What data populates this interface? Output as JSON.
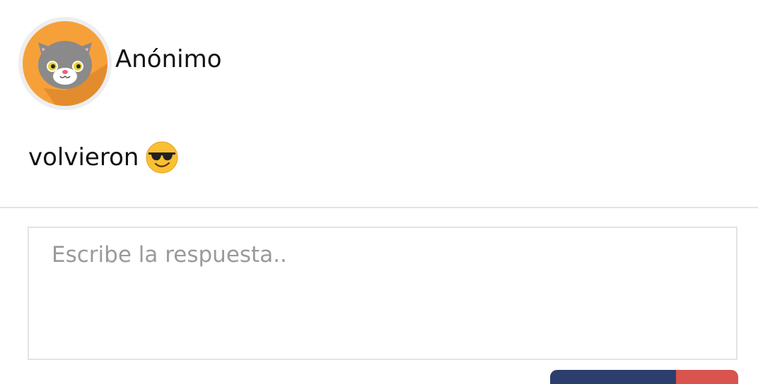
{
  "post": {
    "author": "Anónimo",
    "avatar_icon": "cat-avatar-icon",
    "message": "volvieron",
    "emoji_icon": "sunglasses-smile-emoji-icon"
  },
  "reply": {
    "placeholder": "Escribe la respuesta.."
  },
  "colors": {
    "avatar_bg": "#F6A03A",
    "submit_button": "#2C3E6B",
    "cancel_button": "#D9534F"
  }
}
